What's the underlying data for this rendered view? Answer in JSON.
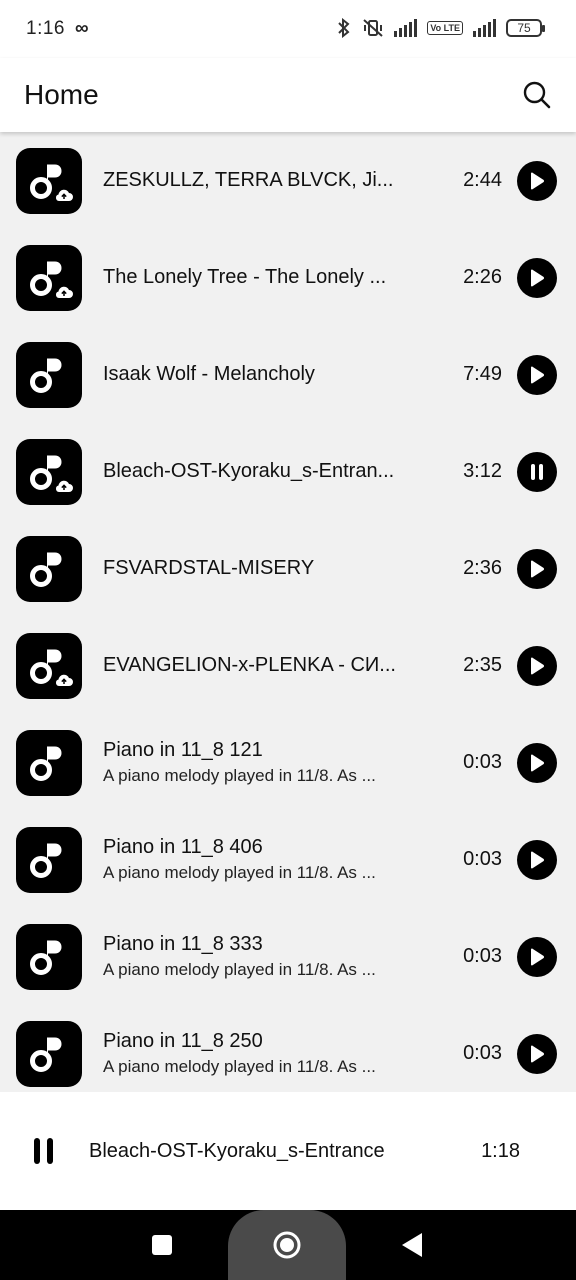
{
  "status": {
    "time": "1:16",
    "battery": "75",
    "lte": "Vo LTE"
  },
  "header": {
    "title": "Home"
  },
  "tracks": [
    {
      "title": "ZESKULLZ, TERRA BLVCK, Ji...",
      "subtitle": "",
      "duration": "2:44",
      "cloud": true,
      "state": "play"
    },
    {
      "title": "The Lonely Tree - The Lonely ...",
      "subtitle": "",
      "duration": "2:26",
      "cloud": true,
      "state": "play"
    },
    {
      "title": "Isaak Wolf - Melancholy",
      "subtitle": "",
      "duration": "7:49",
      "cloud": false,
      "state": "play"
    },
    {
      "title": "Bleach-OST-Kyoraku_s-Entran...",
      "subtitle": "",
      "duration": "3:12",
      "cloud": true,
      "state": "pause"
    },
    {
      "title": "FSVARDSTAL-MISERY",
      "subtitle": "",
      "duration": "2:36",
      "cloud": false,
      "state": "play"
    },
    {
      "title": "EVANGELION-x-PLENKA - СИ...",
      "subtitle": "",
      "duration": "2:35",
      "cloud": true,
      "state": "play"
    },
    {
      "title": "Piano in 11_8 121",
      "subtitle": "A piano melody played in 11/8. As ...",
      "duration": "0:03",
      "cloud": false,
      "state": "play"
    },
    {
      "title": "Piano in 11_8 406",
      "subtitle": "A piano melody played in 11/8. As ...",
      "duration": "0:03",
      "cloud": false,
      "state": "play"
    },
    {
      "title": "Piano in 11_8 333",
      "subtitle": "A piano melody played in 11/8. As ...",
      "duration": "0:03",
      "cloud": false,
      "state": "play"
    },
    {
      "title": "Piano in 11_8 250",
      "subtitle": "A piano melody played in 11/8. As ...",
      "duration": "0:03",
      "cloud": false,
      "state": "play"
    }
  ],
  "now_playing": {
    "title": "Bleach-OST-Kyoraku_s-Entrance",
    "elapsed": "1:18"
  },
  "colors": {
    "background": "#f1f1f1",
    "accent": "#000000",
    "surface": "#ffffff"
  }
}
